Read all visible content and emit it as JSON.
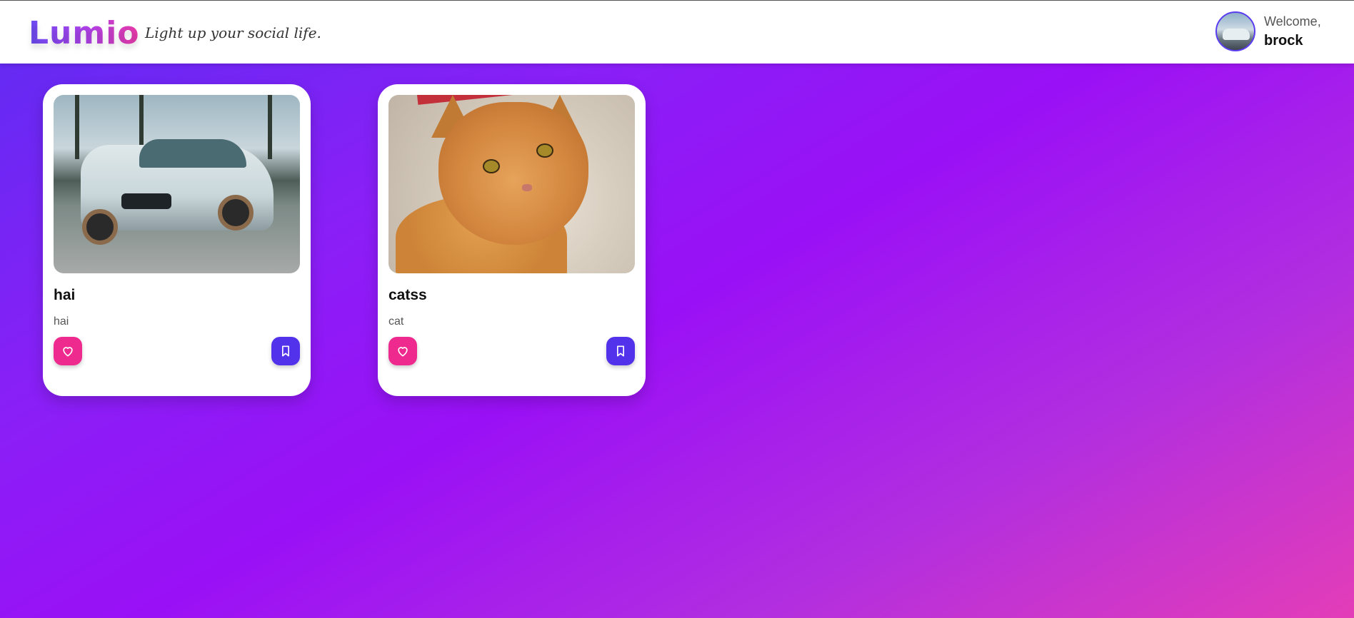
{
  "header": {
    "logo": "Lumio",
    "tagline": "Light up your social life.",
    "welcome_label": "Welcome,",
    "username": "brock",
    "avatar": "avatar-car-photo"
  },
  "posts": [
    {
      "title": "hai",
      "description": "hai",
      "image": "white-sedan-photo",
      "like_icon": "heart-icon",
      "save_icon": "bookmark-icon"
    },
    {
      "title": "catss",
      "description": "cat",
      "image": "orange-cat-photo",
      "like_icon": "heart-icon",
      "save_icon": "bookmark-icon"
    }
  ],
  "colors": {
    "like_button": "#ee2a8f",
    "save_button": "#5232ea",
    "background_start": "#5e2cf2",
    "background_end": "#e33db8"
  }
}
